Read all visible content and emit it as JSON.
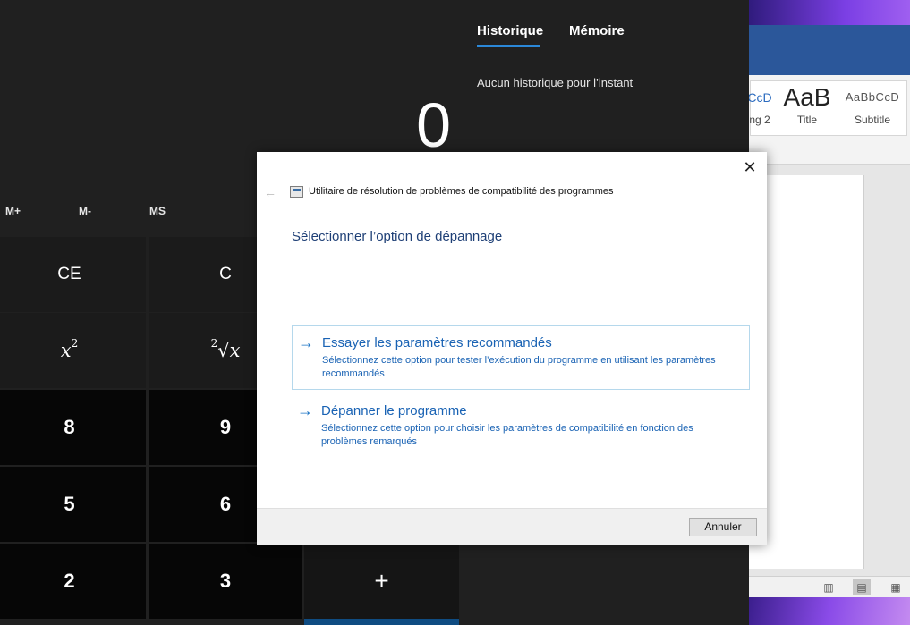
{
  "calculator": {
    "display_value": "0",
    "memory_buttons": [
      "M+",
      "M-",
      "MS"
    ],
    "keys": {
      "ce": "CE",
      "c": "C",
      "square_base": "x",
      "square_exp": "2",
      "root_index": "2",
      "root_symbol": "√",
      "root_var": "x",
      "k8": "8",
      "k9": "9",
      "k5": "5",
      "k6": "6",
      "k2": "2",
      "k3": "3",
      "plus": "+"
    },
    "history": {
      "tab_history": "Historique",
      "tab_memory": "Mémoire",
      "empty_text": "Aucun historique pour l’instant"
    }
  },
  "word": {
    "styles": [
      {
        "preview": "CcD",
        "name": "ng 2"
      },
      {
        "preview": "AaB",
        "name": "Title"
      },
      {
        "preview": "AaBbCcD",
        "name": "Subtitle"
      }
    ]
  },
  "dialog": {
    "close_label": "✕",
    "back_label": "←",
    "app_title": "Utilitaire de résolution de problèmes de compatibilité des programmes",
    "heading": "Sélectionner l’option de dépannage",
    "options": [
      {
        "title": "Essayer les paramètres recommandés",
        "description": "Sélectionnez cette option pour tester l’exécution du programme en utilisant les paramètres recommandés"
      },
      {
        "title": "Dépanner le programme",
        "description": "Sélectionnez cette option pour choisir les paramètres de compatibilité en fonction des problèmes remarqués"
      }
    ],
    "cancel_label": "Annuler"
  },
  "colors": {
    "accent": "#2b88d8",
    "link_blue": "#1a63b4",
    "heading_blue": "#1e3f76"
  }
}
